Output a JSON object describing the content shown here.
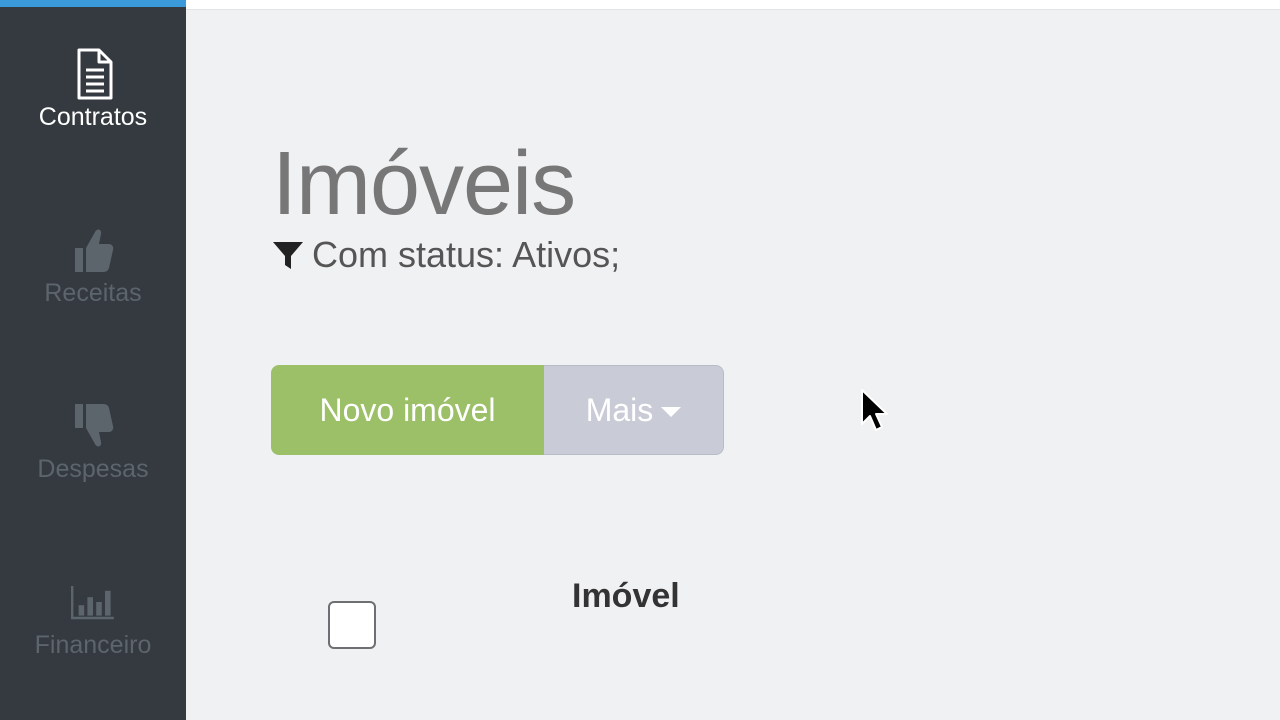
{
  "sidebar": {
    "items": [
      {
        "label": "Contratos",
        "icon": "document-icon",
        "active": true
      },
      {
        "label": "Receitas",
        "icon": "thumbs-up-icon",
        "active": false
      },
      {
        "label": "Despesas",
        "icon": "thumbs-down-icon",
        "active": false
      },
      {
        "label": "Financeiro",
        "icon": "bar-chart-icon",
        "active": false
      }
    ]
  },
  "main": {
    "title": "Imóveis",
    "filter_text": "Com status: Ativos;",
    "buttons": {
      "new_label": "Novo imóvel",
      "more_label": "Mais"
    },
    "table": {
      "columns": [
        "Imóvel"
      ]
    }
  },
  "colors": {
    "sidebar_bg": "#343a40",
    "accent": "#3b9ad9",
    "primary_button": "#9cc068",
    "secondary_button": "#c9ccd6",
    "page_bg": "#f0f1f3"
  }
}
